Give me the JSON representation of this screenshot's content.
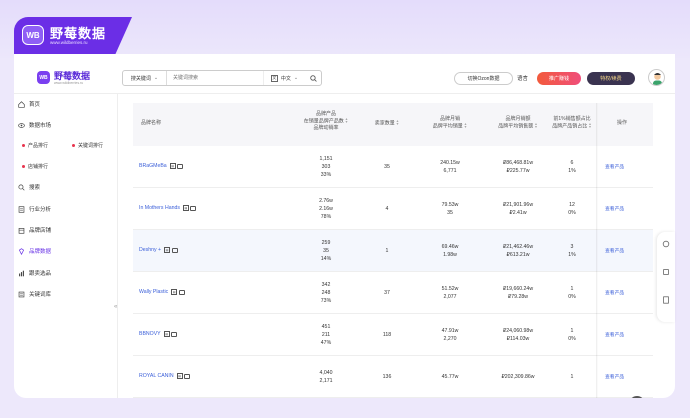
{
  "brand": {
    "logo_text": "WB",
    "title": "野莓数据",
    "url": "www.wildberries.ru"
  },
  "header": {
    "logo_small": "WB",
    "logo_title": "野莓数据",
    "logo_url": "www.wildberries.ru",
    "search": {
      "type_label": "搜关键词",
      "placeholder": "关键词搜索",
      "language": "中文"
    },
    "ozon_button": "切换Ozon数据",
    "language_label": "语言",
    "promo_button": "推广赚钱",
    "vip_button": "特权/续费"
  },
  "sidebar": {
    "items": [
      {
        "label": "首页",
        "icon": "home-icon"
      },
      {
        "label": "数据市场",
        "icon": "eye-icon"
      },
      {
        "label": "搜索",
        "icon": "search-icon"
      },
      {
        "label": "行业分析",
        "icon": "doc-icon"
      },
      {
        "label": "品牌店铺",
        "icon": "shop-icon"
      },
      {
        "label": "品牌数据",
        "icon": "diamond-icon"
      },
      {
        "label": "跟卖选品",
        "icon": "bar-chart-icon"
      },
      {
        "label": "关键词库",
        "icon": "list-icon"
      }
    ],
    "subitems": [
      "产品排行",
      "关键词排行",
      "店铺排行"
    ],
    "collapse_glyph": "«"
  },
  "table": {
    "headers": {
      "brand": "品牌名称",
      "sales": [
        "品牌产品",
        "在销量品牌产品数",
        "品牌动销率"
      ],
      "sellers": "卖家数量",
      "avg_price": [
        "品牌月销",
        "品牌平均销量"
      ],
      "avg_revenue": [
        "品牌月销额",
        "品牌平均销售额"
      ],
      "top_share": [
        "前1%销售额占比",
        "品牌产品销占比"
      ],
      "action": "操作"
    },
    "rows": [
      {
        "brand": "BRaGMeBa",
        "sales": [
          "1,151",
          "303",
          "33%"
        ],
        "sellers": "35",
        "avg_price": [
          "240.15w",
          "6,771"
        ],
        "avg_revenue": [
          "₽86,468.81w",
          "₽225.77w"
        ],
        "top_share": [
          "6",
          "1%"
        ],
        "action": "查看产品"
      },
      {
        "brand": "In Mothers Hands",
        "sales": [
          "2.76w",
          "2.16w",
          "78%"
        ],
        "sellers": "4",
        "avg_price": [
          "79.53w",
          "35"
        ],
        "avg_revenue": [
          "₽21,901.96w",
          "₽2.41w"
        ],
        "top_share": [
          "12",
          "0%"
        ],
        "action": "查看产品"
      },
      {
        "brand": "Deshny +",
        "sales": [
          "259",
          "35",
          "14%"
        ],
        "sellers": "1",
        "avg_price": [
          "69.46w",
          "1.98w"
        ],
        "avg_revenue": [
          "₽21,462.46w",
          "₽613.21w"
        ],
        "top_share": [
          "3",
          "1%"
        ],
        "action": "查看产品"
      },
      {
        "brand": "Wally Plastic",
        "sales": [
          "342",
          "248",
          "73%"
        ],
        "sellers": "37",
        "avg_price": [
          "51.52w",
          "2,077"
        ],
        "avg_revenue": [
          "₽19,660.24w",
          "₽79.28w"
        ],
        "top_share": [
          "1",
          "0%"
        ],
        "action": "查看产品"
      },
      {
        "brand": "BBNOVY",
        "sales": [
          "451",
          "211",
          "47%"
        ],
        "sellers": "118",
        "avg_price": [
          "47.91w",
          "2,270"
        ],
        "avg_revenue": [
          "₽24,060.98w",
          "₽114.03w"
        ],
        "top_share": [
          "1",
          "0%"
        ],
        "action": "查看产品"
      },
      {
        "brand": "ROYAL CANIN",
        "sales": [
          "4,040",
          "2,171"
        ],
        "sellers": "136",
        "avg_price": [
          "45.77w"
        ],
        "avg_revenue": [
          "₽202,309.86w"
        ],
        "top_share": [
          "1"
        ],
        "action": "查看产品"
      }
    ]
  },
  "scroll_top_glyph": "↑",
  "colors": {
    "accent": "#6b2ee6",
    "link": "#3b5fd9",
    "promo": "#f25a3c"
  }
}
